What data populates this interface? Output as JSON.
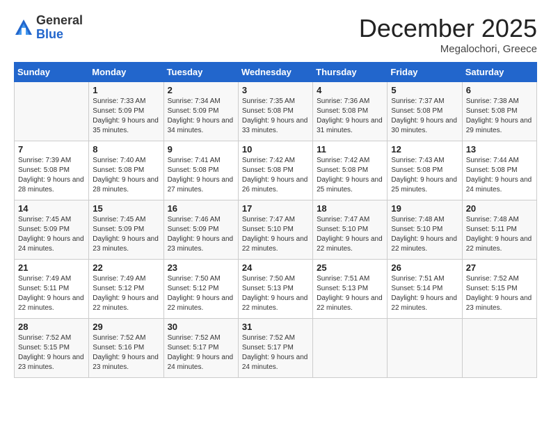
{
  "logo": {
    "general": "General",
    "blue": "Blue"
  },
  "header": {
    "month": "December 2025",
    "location": "Megalochori, Greece"
  },
  "weekdays": [
    "Sunday",
    "Monday",
    "Tuesday",
    "Wednesday",
    "Thursday",
    "Friday",
    "Saturday"
  ],
  "weeks": [
    [
      {
        "day": "",
        "sunrise": "",
        "sunset": "",
        "daylight": ""
      },
      {
        "day": "1",
        "sunrise": "Sunrise: 7:33 AM",
        "sunset": "Sunset: 5:09 PM",
        "daylight": "Daylight: 9 hours and 35 minutes."
      },
      {
        "day": "2",
        "sunrise": "Sunrise: 7:34 AM",
        "sunset": "Sunset: 5:09 PM",
        "daylight": "Daylight: 9 hours and 34 minutes."
      },
      {
        "day": "3",
        "sunrise": "Sunrise: 7:35 AM",
        "sunset": "Sunset: 5:08 PM",
        "daylight": "Daylight: 9 hours and 33 minutes."
      },
      {
        "day": "4",
        "sunrise": "Sunrise: 7:36 AM",
        "sunset": "Sunset: 5:08 PM",
        "daylight": "Daylight: 9 hours and 31 minutes."
      },
      {
        "day": "5",
        "sunrise": "Sunrise: 7:37 AM",
        "sunset": "Sunset: 5:08 PM",
        "daylight": "Daylight: 9 hours and 30 minutes."
      },
      {
        "day": "6",
        "sunrise": "Sunrise: 7:38 AM",
        "sunset": "Sunset: 5:08 PM",
        "daylight": "Daylight: 9 hours and 29 minutes."
      }
    ],
    [
      {
        "day": "7",
        "sunrise": "Sunrise: 7:39 AM",
        "sunset": "Sunset: 5:08 PM",
        "daylight": "Daylight: 9 hours and 28 minutes."
      },
      {
        "day": "8",
        "sunrise": "Sunrise: 7:40 AM",
        "sunset": "Sunset: 5:08 PM",
        "daylight": "Daylight: 9 hours and 28 minutes."
      },
      {
        "day": "9",
        "sunrise": "Sunrise: 7:41 AM",
        "sunset": "Sunset: 5:08 PM",
        "daylight": "Daylight: 9 hours and 27 minutes."
      },
      {
        "day": "10",
        "sunrise": "Sunrise: 7:42 AM",
        "sunset": "Sunset: 5:08 PM",
        "daylight": "Daylight: 9 hours and 26 minutes."
      },
      {
        "day": "11",
        "sunrise": "Sunrise: 7:42 AM",
        "sunset": "Sunset: 5:08 PM",
        "daylight": "Daylight: 9 hours and 25 minutes."
      },
      {
        "day": "12",
        "sunrise": "Sunrise: 7:43 AM",
        "sunset": "Sunset: 5:08 PM",
        "daylight": "Daylight: 9 hours and 25 minutes."
      },
      {
        "day": "13",
        "sunrise": "Sunrise: 7:44 AM",
        "sunset": "Sunset: 5:08 PM",
        "daylight": "Daylight: 9 hours and 24 minutes."
      }
    ],
    [
      {
        "day": "14",
        "sunrise": "Sunrise: 7:45 AM",
        "sunset": "Sunset: 5:09 PM",
        "daylight": "Daylight: 9 hours and 24 minutes."
      },
      {
        "day": "15",
        "sunrise": "Sunrise: 7:45 AM",
        "sunset": "Sunset: 5:09 PM",
        "daylight": "Daylight: 9 hours and 23 minutes."
      },
      {
        "day": "16",
        "sunrise": "Sunrise: 7:46 AM",
        "sunset": "Sunset: 5:09 PM",
        "daylight": "Daylight: 9 hours and 23 minutes."
      },
      {
        "day": "17",
        "sunrise": "Sunrise: 7:47 AM",
        "sunset": "Sunset: 5:10 PM",
        "daylight": "Daylight: 9 hours and 22 minutes."
      },
      {
        "day": "18",
        "sunrise": "Sunrise: 7:47 AM",
        "sunset": "Sunset: 5:10 PM",
        "daylight": "Daylight: 9 hours and 22 minutes."
      },
      {
        "day": "19",
        "sunrise": "Sunrise: 7:48 AM",
        "sunset": "Sunset: 5:10 PM",
        "daylight": "Daylight: 9 hours and 22 minutes."
      },
      {
        "day": "20",
        "sunrise": "Sunrise: 7:48 AM",
        "sunset": "Sunset: 5:11 PM",
        "daylight": "Daylight: 9 hours and 22 minutes."
      }
    ],
    [
      {
        "day": "21",
        "sunrise": "Sunrise: 7:49 AM",
        "sunset": "Sunset: 5:11 PM",
        "daylight": "Daylight: 9 hours and 22 minutes."
      },
      {
        "day": "22",
        "sunrise": "Sunrise: 7:49 AM",
        "sunset": "Sunset: 5:12 PM",
        "daylight": "Daylight: 9 hours and 22 minutes."
      },
      {
        "day": "23",
        "sunrise": "Sunrise: 7:50 AM",
        "sunset": "Sunset: 5:12 PM",
        "daylight": "Daylight: 9 hours and 22 minutes."
      },
      {
        "day": "24",
        "sunrise": "Sunrise: 7:50 AM",
        "sunset": "Sunset: 5:13 PM",
        "daylight": "Daylight: 9 hours and 22 minutes."
      },
      {
        "day": "25",
        "sunrise": "Sunrise: 7:51 AM",
        "sunset": "Sunset: 5:13 PM",
        "daylight": "Daylight: 9 hours and 22 minutes."
      },
      {
        "day": "26",
        "sunrise": "Sunrise: 7:51 AM",
        "sunset": "Sunset: 5:14 PM",
        "daylight": "Daylight: 9 hours and 22 minutes."
      },
      {
        "day": "27",
        "sunrise": "Sunrise: 7:52 AM",
        "sunset": "Sunset: 5:15 PM",
        "daylight": "Daylight: 9 hours and 23 minutes."
      }
    ],
    [
      {
        "day": "28",
        "sunrise": "Sunrise: 7:52 AM",
        "sunset": "Sunset: 5:15 PM",
        "daylight": "Daylight: 9 hours and 23 minutes."
      },
      {
        "day": "29",
        "sunrise": "Sunrise: 7:52 AM",
        "sunset": "Sunset: 5:16 PM",
        "daylight": "Daylight: 9 hours and 23 minutes."
      },
      {
        "day": "30",
        "sunrise": "Sunrise: 7:52 AM",
        "sunset": "Sunset: 5:17 PM",
        "daylight": "Daylight: 9 hours and 24 minutes."
      },
      {
        "day": "31",
        "sunrise": "Sunrise: 7:52 AM",
        "sunset": "Sunset: 5:17 PM",
        "daylight": "Daylight: 9 hours and 24 minutes."
      },
      {
        "day": "",
        "sunrise": "",
        "sunset": "",
        "daylight": ""
      },
      {
        "day": "",
        "sunrise": "",
        "sunset": "",
        "daylight": ""
      },
      {
        "day": "",
        "sunrise": "",
        "sunset": "",
        "daylight": ""
      }
    ]
  ]
}
